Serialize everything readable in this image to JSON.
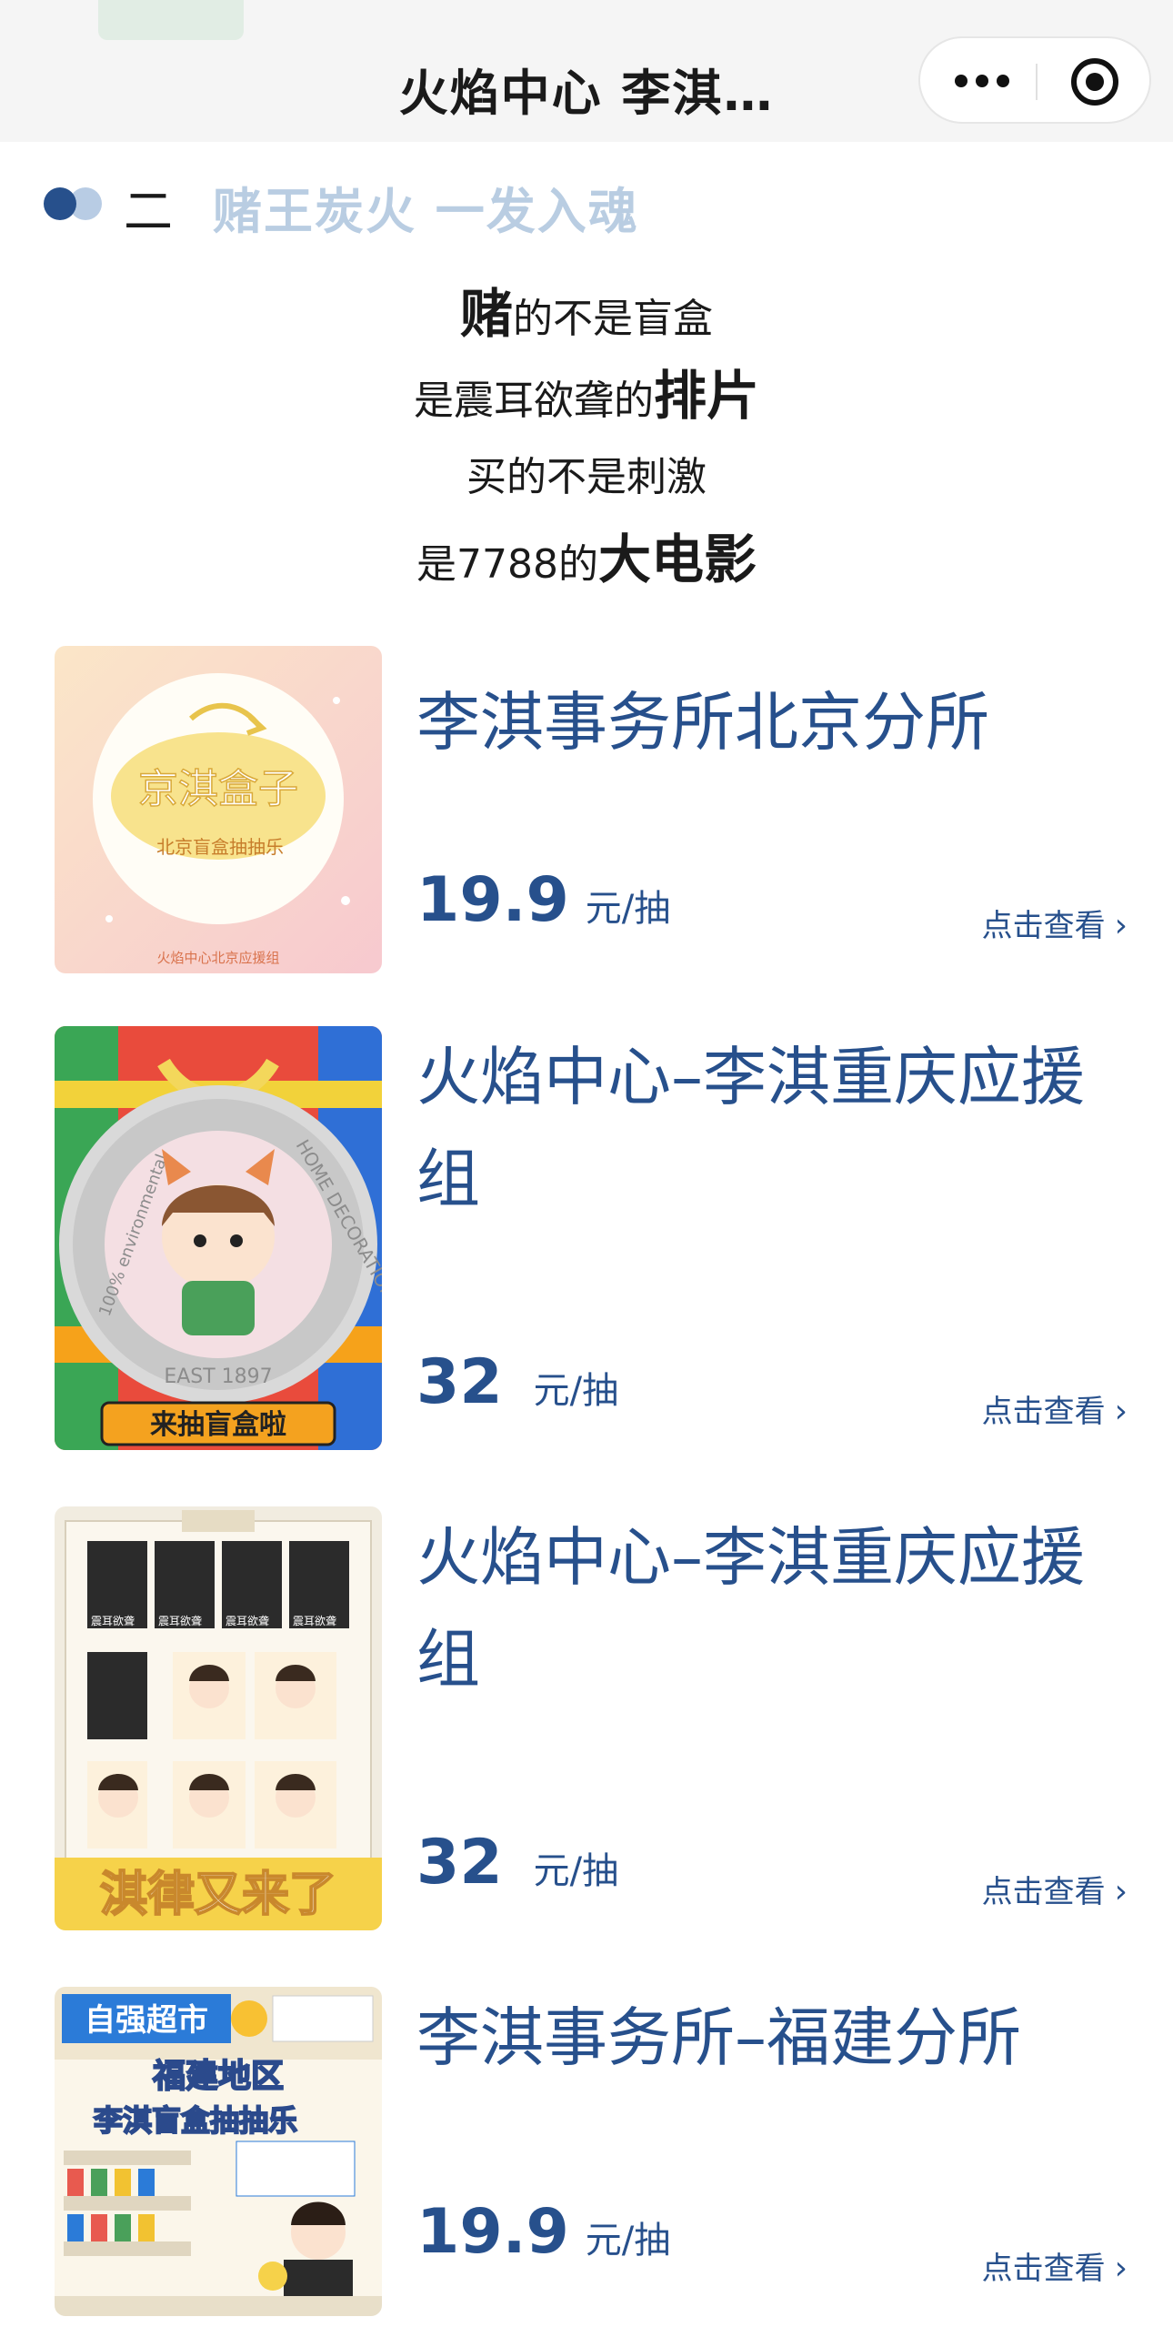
{
  "nav": {
    "title": "火焰中心 李淇…",
    "more_icon": "more-dots-icon",
    "close_icon": "target-icon"
  },
  "section": {
    "number": "二",
    "title": "赌王炭火 一发入魂"
  },
  "poem": {
    "line1_bold": "赌",
    "line1_rest": "的不是盲盒",
    "line2_text": "是震耳欲聋的",
    "line2_bold": "排片",
    "line3_text": "买的不是刺激",
    "line4_text": "是7788的",
    "line4_bold": "大电影"
  },
  "products": [
    {
      "title": "李淇事务所北京分所",
      "price": "19.9",
      "unit": "元/抽",
      "link": "点击查看",
      "image": {
        "caption": "京淇盒子",
        "subcaption": "北京盲盒抽抽乐",
        "footer": "火焰中心北京应援组"
      }
    },
    {
      "title": "火焰中心–李淇重庆应援组",
      "price": "32",
      "unit": "元/抽",
      "link": "点击查看",
      "image": {
        "ring_top": "HOME DECORATION",
        "ring_left": "100% environmental",
        "ring_bottom": "EAST 1897",
        "banner": "来抽盲盒啦"
      }
    },
    {
      "title": "火焰中心–李淇重庆应援组",
      "price": "32",
      "unit": "元/抽",
      "link": "点击查看",
      "image": {
        "card_label": "震耳欲聋",
        "banner": "淇律又来了"
      }
    },
    {
      "title": "李淇事务所–福建分所",
      "price": "19.9",
      "unit": "元/抽",
      "link": "点击查看",
      "image": {
        "shop_sign": "自强超市",
        "line1": "福建地区",
        "line2": "李淇盲盒抽抽乐"
      }
    }
  ],
  "colors": {
    "accent": "#27508c",
    "accent_light": "#b9cde2",
    "nav_bg": "#f5f5f5"
  }
}
